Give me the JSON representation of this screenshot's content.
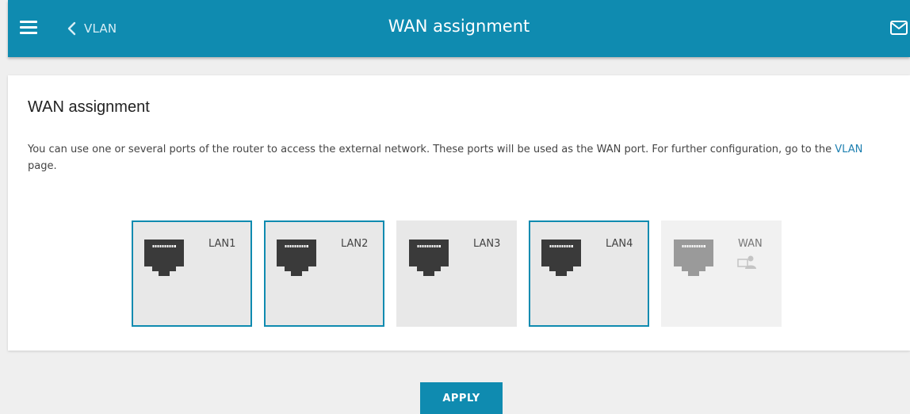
{
  "header": {
    "back_label": "VLAN",
    "title": "WAN assignment",
    "icons": [
      "menu-icon",
      "chevron-left-icon",
      "mail-icon"
    ],
    "bar_color": "#0f8bb0"
  },
  "section": {
    "heading": "WAN assignment",
    "description_before": "You can use one or several ports of the router to access the external network. These ports will be used as the WAN port. For further configuration, go to the ",
    "description_link": "VLAN",
    "description_after": " page."
  },
  "ports": [
    {
      "label": "LAN1",
      "selected": true,
      "icon": "ethernet-port-icon"
    },
    {
      "label": "LAN2",
      "selected": true,
      "icon": "ethernet-port-icon"
    },
    {
      "label": "LAN3",
      "selected": false,
      "icon": "ethernet-port-icon"
    },
    {
      "label": "LAN4",
      "selected": true,
      "icon": "ethernet-port-icon"
    },
    {
      "label": "WAN",
      "selected": false,
      "disabled": true,
      "icon": "ethernet-port-icon",
      "badge_icon": "wan-user-icon"
    }
  ],
  "actions": {
    "apply_label": "APPLY"
  },
  "colors": {
    "accent": "#0f8bb0",
    "link": "#1d7fb0",
    "port_icon": "#3a3a3a",
    "port_icon_disabled": "#9a9a9a"
  }
}
